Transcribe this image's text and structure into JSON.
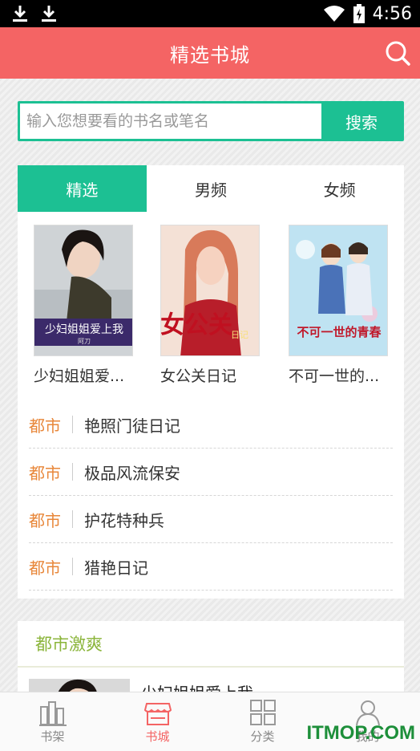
{
  "status_bar": {
    "time": "4:56",
    "icons": [
      "download-icon",
      "download-icon",
      "wifi-icon",
      "battery-charging-icon"
    ]
  },
  "appbar": {
    "title": "精选书城",
    "search_icon": "search-icon"
  },
  "search": {
    "placeholder": "输入您想要看的书名或笔名",
    "button_label": "搜索"
  },
  "tabs": [
    {
      "label": "精选",
      "active": true
    },
    {
      "label": "男频",
      "active": false
    },
    {
      "label": "女频",
      "active": false
    }
  ],
  "featured_books": [
    {
      "title": "少妇姐姐爱...",
      "cover_text": "少妇姐姐爱上我",
      "cover_author": "阿刀"
    },
    {
      "title": "女公关日记",
      "cover_text": "女公关",
      "cover_subtext": "日记"
    },
    {
      "title": "不可一世的...",
      "cover_text": "不可一世的青春"
    }
  ],
  "book_list": [
    {
      "category": "都市",
      "title": "艳照门徒日记"
    },
    {
      "category": "都市",
      "title": "极品风流保安"
    },
    {
      "category": "都市",
      "title": "护花特种兵"
    },
    {
      "category": "都市",
      "title": "猎艳日记"
    }
  ],
  "section": {
    "title": "都市激爽",
    "first_book_title": "少妇姐姐爱上我"
  },
  "bottom_nav": [
    {
      "label": "书架",
      "icon": "bookshelf-icon",
      "active": false
    },
    {
      "label": "书城",
      "icon": "store-icon",
      "active": true
    },
    {
      "label": "分类",
      "icon": "grid-icon",
      "active": false
    },
    {
      "label": "我的",
      "icon": "user-icon",
      "active": false
    }
  ],
  "watermark": "ITMOP.COM",
  "colors": {
    "appbar": "#f46464",
    "accent": "#1cc093",
    "category": "#e8873a",
    "section_title": "#8bb53b"
  }
}
